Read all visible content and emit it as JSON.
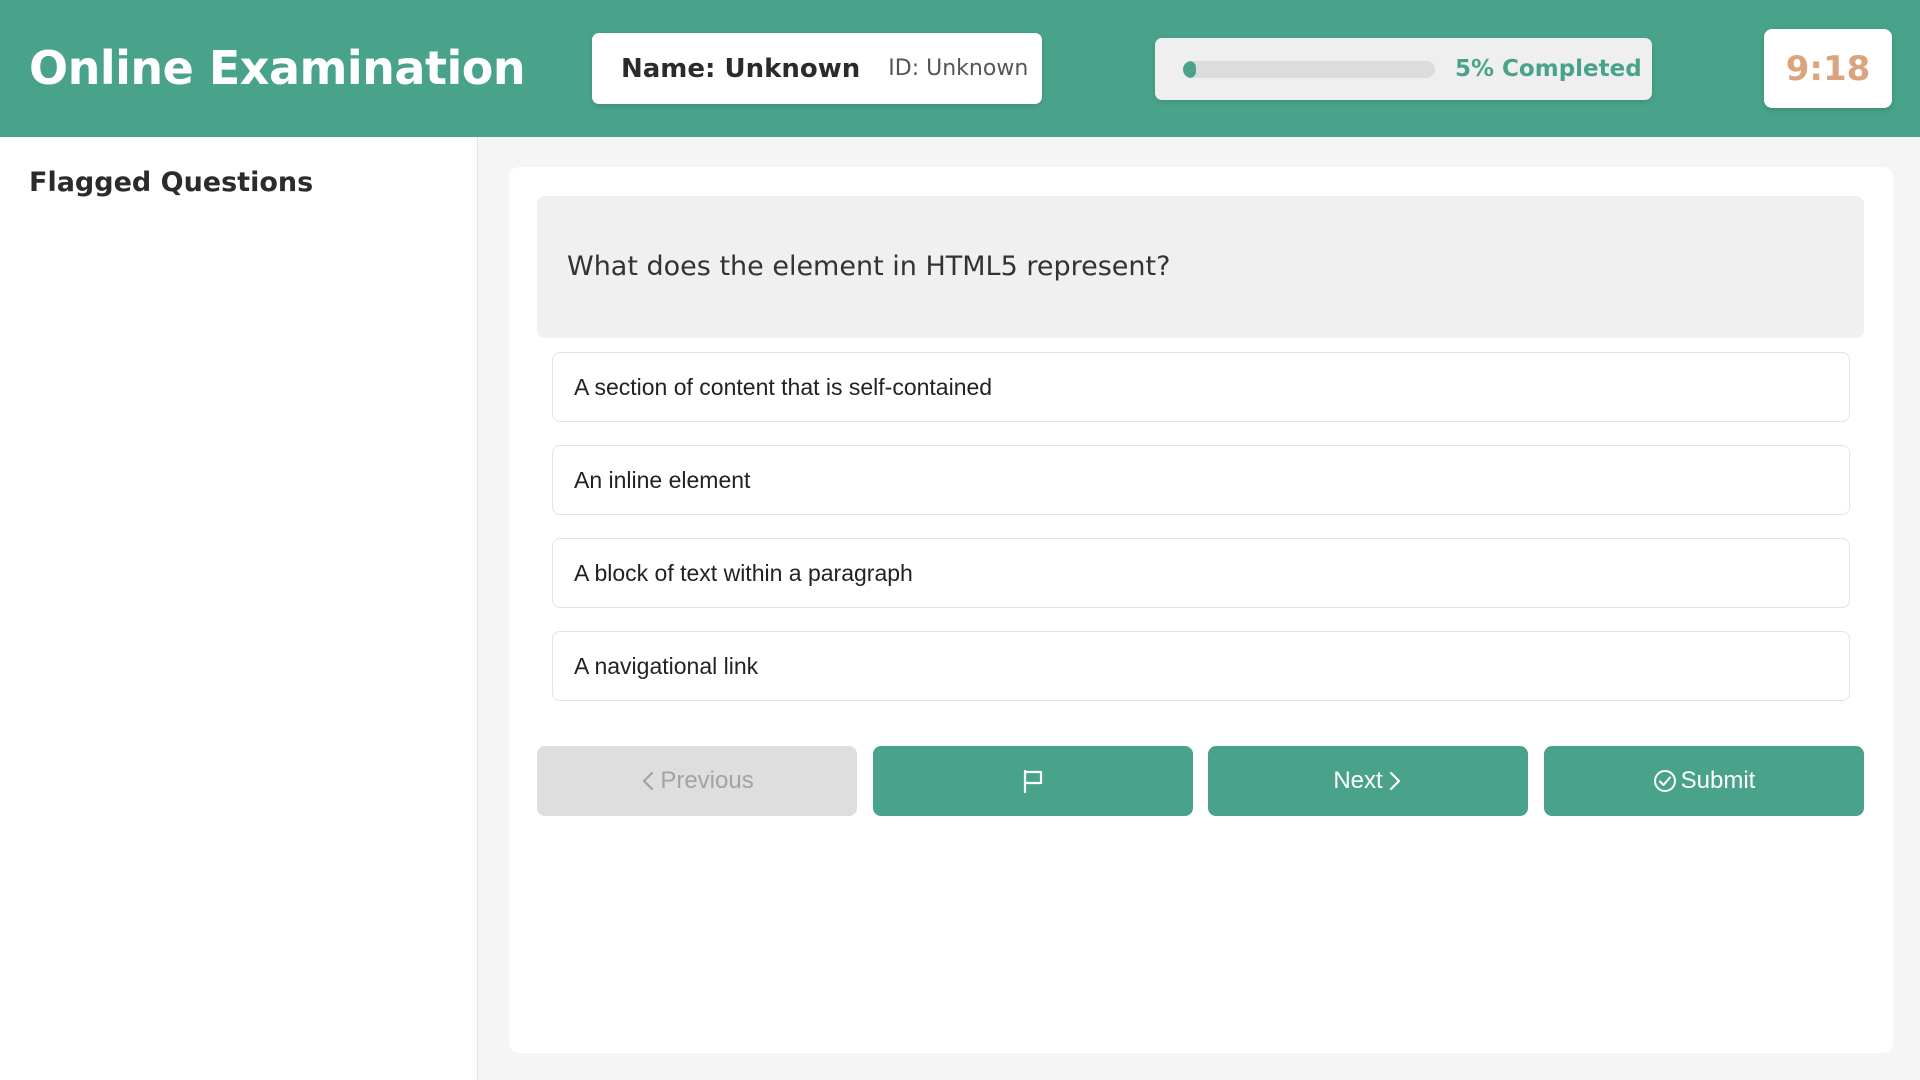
{
  "header": {
    "title": "Online Examination",
    "student_name": "Name: Unknown",
    "student_id": "ID: Unknown",
    "progress_percent": 5,
    "progress_label": "5% Completed",
    "timer": "9:18"
  },
  "sidebar": {
    "title": "Flagged Questions"
  },
  "question": {
    "text": "What does the element in HTML5 represent?",
    "options": [
      "A section of content that is self-contained",
      "An inline element",
      "A block of text within a paragraph",
      "A navigational link"
    ]
  },
  "actions": {
    "previous_label": "Previous",
    "next_label": "Next",
    "submit_label": "Submit",
    "flag_icon": "flag-icon"
  },
  "colors": {
    "brand": "#49a38a",
    "timer": "#d9a47e",
    "disabled": "#dedede"
  }
}
